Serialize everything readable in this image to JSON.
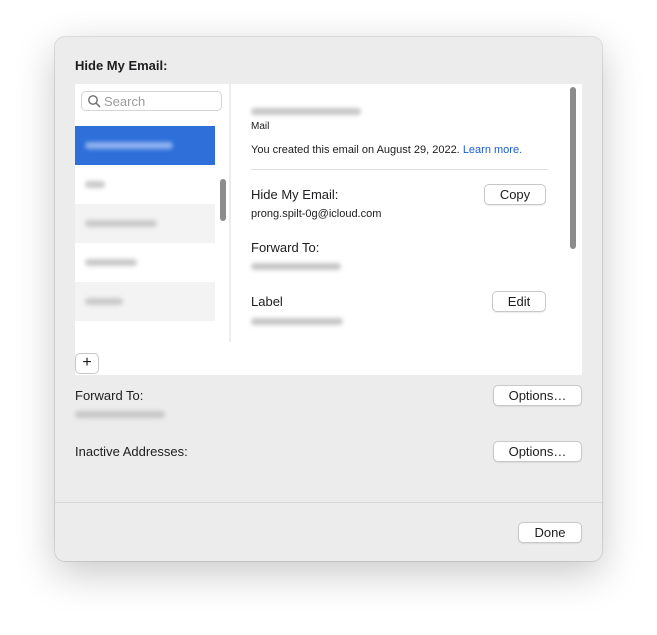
{
  "dialog": {
    "title": "Hide My Email:"
  },
  "search": {
    "placeholder": "Search",
    "icon": "magnifying-glass-icon"
  },
  "list": {
    "selected_index": 0,
    "item_count": 5
  },
  "detail": {
    "source_app": "Mail",
    "created_text": "You created this email on August 29, 2022.",
    "learn_more": "Learn more.",
    "hide_my_email_label": "Hide My Email:",
    "hide_my_email_value": "prong.spilt-0g@icloud.com",
    "copy_button": "Copy",
    "forward_to_label": "Forward To:",
    "label_label": "Label",
    "edit_button": "Edit"
  },
  "toolbar": {
    "add_button": "+"
  },
  "settings": {
    "forward_to_label": "Forward To:",
    "forward_options_button": "Options…",
    "inactive_label": "Inactive Addresses:",
    "inactive_options_button": "Options…"
  },
  "footer": {
    "done_button": "Done"
  },
  "colors": {
    "accent": "#2e6fd9",
    "link": "#1a5fd1",
    "sheet_background": "#ececec"
  }
}
